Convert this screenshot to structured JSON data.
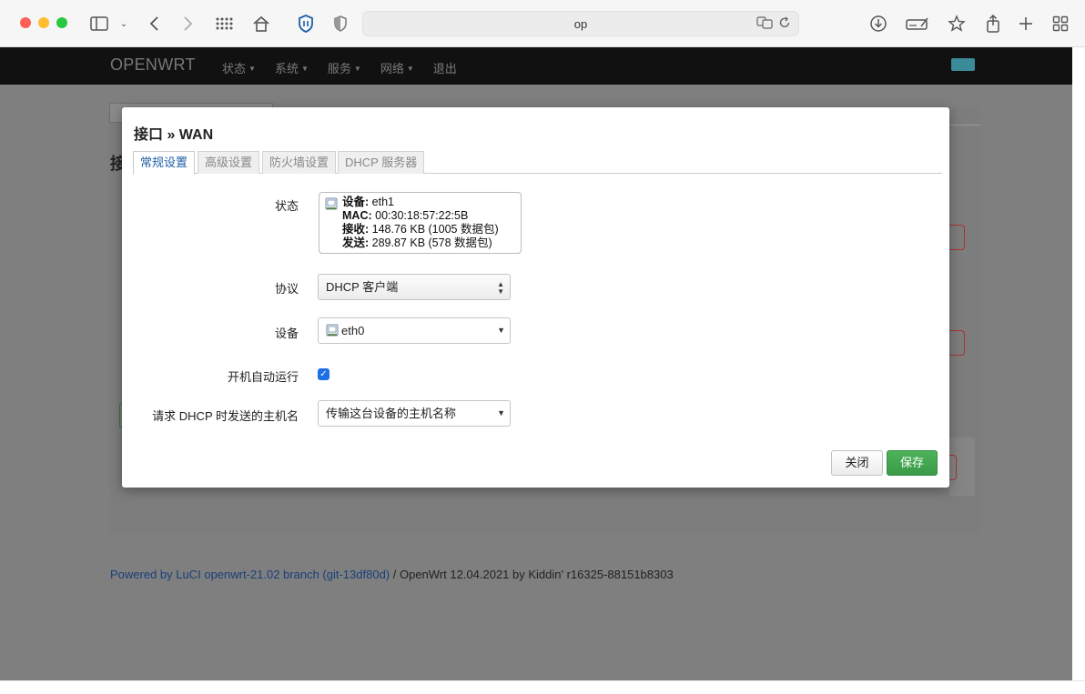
{
  "browser": {
    "address": "op"
  },
  "navbar": {
    "brand": "OPENWRT",
    "menu": [
      {
        "label": "状态",
        "has_caret": true
      },
      {
        "label": "系统",
        "has_caret": true
      },
      {
        "label": "服务",
        "has_caret": true
      },
      {
        "label": "网络",
        "has_caret": true
      },
      {
        "label": "退出",
        "has_caret": false
      }
    ]
  },
  "background": {
    "heading": "接"
  },
  "footer": {
    "link": "Powered by LuCI openwrt-21.02 branch (git-13df80d)",
    "text": " / OpenWrt 12.04.2021 by Kiddin' r16325-88151b8303"
  },
  "modal": {
    "title": "接口 » WAN",
    "tabs": [
      "常规设置",
      "高级设置",
      "防火墙设置",
      "DHCP 服务器"
    ],
    "active_tab": 0,
    "fields": {
      "status_label": "状态",
      "status": {
        "device_key": "设备:",
        "device_val": "eth1",
        "mac_key": "MAC:",
        "mac_val": "00:30:18:57:22:5B",
        "rx_key": "接收:",
        "rx_val": "148.76 KB (1005 数据包)",
        "tx_key": "发送:",
        "tx_val": "289.87 KB (578 数据包)"
      },
      "protocol_label": "协议",
      "protocol_value": "DHCP 客户端",
      "device_label": "设备",
      "device_value": "eth0",
      "autostart_label": "开机自动运行",
      "autostart_checked": true,
      "hostname_label": "请求 DHCP 时发送的主机名",
      "hostname_value": "传输这台设备的主机名称"
    },
    "buttons": {
      "close": "关闭",
      "save": "保存"
    }
  },
  "colors": {
    "accent_tab": "#1f5fa8",
    "save_button": "#3b9a47",
    "checkbox": "#1e6fe6"
  }
}
